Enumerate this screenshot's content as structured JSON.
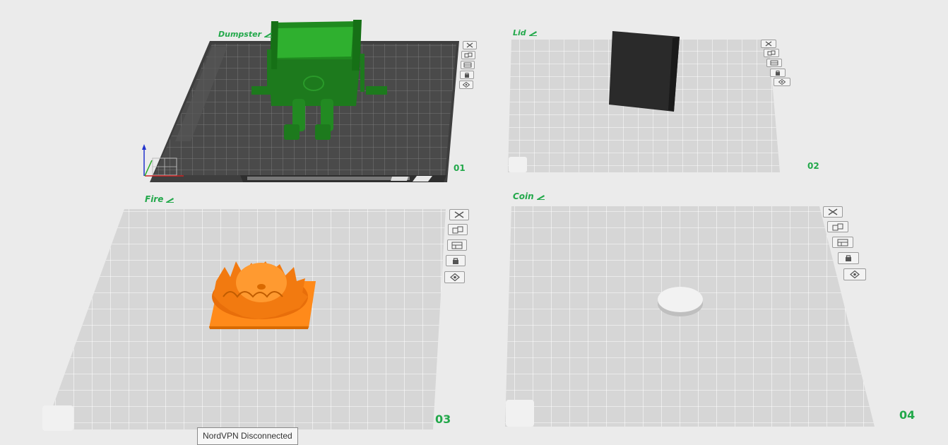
{
  "plates": [
    {
      "name": "Dumpster",
      "number": "01"
    },
    {
      "name": "Lid",
      "number": "02"
    },
    {
      "name": "Fire",
      "number": "03"
    },
    {
      "name": "Coin",
      "number": "04"
    }
  ],
  "plate_controls": [
    "close-icon",
    "arrange-icon",
    "plate-settings-icon",
    "lock-icon",
    "slice-icon"
  ],
  "tooltip": {
    "text": "NordVPN Disconnected"
  },
  "colors": {
    "label_green": "#22a84a",
    "dumpster_model": "#1e7a1e",
    "lid_model": "#262626",
    "fire_model": "#ff8a1a",
    "coin_model": "#efefef",
    "active_plate": "#4a4a4a",
    "inactive_plate": "#dcdcdc"
  }
}
